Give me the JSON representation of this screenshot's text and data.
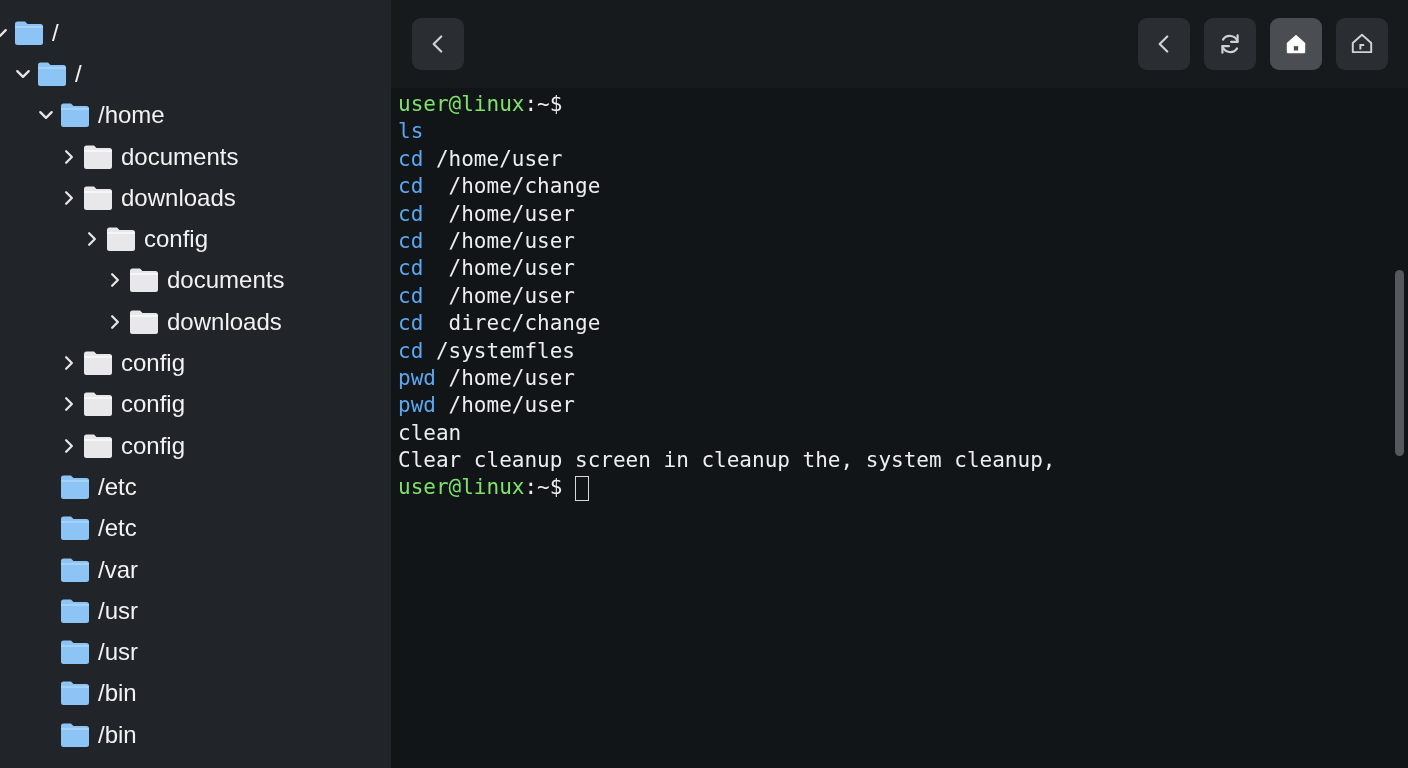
{
  "tree": [
    {
      "name": "/",
      "kind": "system",
      "expanded": true,
      "children": [
        {
          "name": "/",
          "kind": "system",
          "expanded": true,
          "children": [
            {
              "name": "/home",
              "kind": "system",
              "expanded": true,
              "children": [
                {
                  "name": "documents",
                  "kind": "user",
                  "expanded": false
                },
                {
                  "name": "downloads",
                  "kind": "user",
                  "expanded": false,
                  "children": [
                    {
                      "name": "config",
                      "kind": "user",
                      "expanded": false,
                      "children": [
                        {
                          "name": "documents",
                          "kind": "user",
                          "expanded": false
                        },
                        {
                          "name": "downloads",
                          "kind": "user",
                          "expanded": false
                        }
                      ]
                    }
                  ]
                },
                {
                  "name": "config",
                  "kind": "user",
                  "expanded": false
                },
                {
                  "name": "config",
                  "kind": "user",
                  "expanded": false
                },
                {
                  "name": "config",
                  "kind": "user",
                  "expanded": false
                }
              ]
            },
            {
              "name": "/etc",
              "kind": "system"
            },
            {
              "name": "/etc",
              "kind": "system"
            },
            {
              "name": "/var",
              "kind": "system"
            },
            {
              "name": "/usr",
              "kind": "system"
            },
            {
              "name": "/usr",
              "kind": "system"
            },
            {
              "name": "/bin",
              "kind": "system"
            },
            {
              "name": "/bin",
              "kind": "system"
            }
          ]
        }
      ]
    }
  ],
  "toolbar": {
    "left": [
      {
        "kind": "back",
        "selected": false
      }
    ],
    "right": [
      {
        "kind": "back",
        "selected": false
      },
      {
        "kind": "refresh",
        "selected": false
      },
      {
        "kind": "home",
        "selected": true
      },
      {
        "kind": "home-outline",
        "selected": false
      }
    ]
  },
  "terminal": {
    "lines": [
      {
        "kind": "prompt",
        "text": "user@linux",
        "suffix": ":~$"
      },
      {
        "kind": "command",
        "command": "ls"
      },
      {
        "kind": "command",
        "command": "cd",
        "args": " /home/user"
      },
      {
        "kind": "command",
        "command": "cd",
        "args": "  /home/change"
      },
      {
        "kind": "command",
        "command": "cd",
        "args": "  /home/user"
      },
      {
        "kind": "command",
        "command": "cd",
        "args": "  /home/user"
      },
      {
        "kind": "command",
        "command": "cd",
        "args": "  /home/user"
      },
      {
        "kind": "command",
        "command": "cd",
        "args": "  /home/user"
      },
      {
        "kind": "command",
        "command": "cd",
        "args": "  direc/change"
      },
      {
        "kind": "command",
        "command": "cd",
        "args": " /systemfles"
      },
      {
        "kind": "command",
        "command": "pwd",
        "args": " /home/user"
      },
      {
        "kind": "command",
        "command": "pwd",
        "args": " /home/user"
      },
      {
        "kind": "output",
        "text": "clean"
      },
      {
        "kind": "output",
        "text": "Clear cleanup screen in cleanup the, system cleanup,"
      },
      {
        "kind": "prompt",
        "text": "user@linux",
        "suffix": ":~$",
        "cursor": true
      }
    ]
  }
}
